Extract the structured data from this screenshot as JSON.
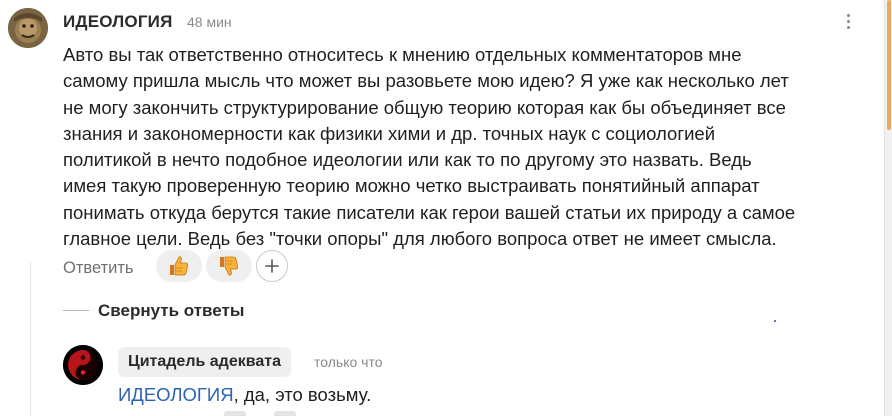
{
  "comment": {
    "author": "ИДЕОЛОГИЯ",
    "time": "48 мин",
    "text_lines": [
      "Авто вы так ответственно относитесь к мнению отдельных комментаторов мне",
      "самому пришла мысль что может вы разовьете мою идею? Я уже как несколько лет",
      "не могу закончить структурирование общую теорию которая как бы объединяет все",
      "знания и закономерности как физики хими и др. точных наук с социологией",
      "политикой в нечто подобное идеологии или как то по другому это назвать. Ведь",
      "имея такую проверенную теорию можно четко выстраивать понятийный аппарат",
      "понимать откуда берутся такие писатели как герои вашей статьи их природу а самое",
      "главное цели. Ведь без \"точки опоры\" для любого вопроса ответ не имеет смысла."
    ],
    "reply_label": "Ответить",
    "icons": {
      "like": "thumbs-up-emoji",
      "dislike": "thumbs-down-emoji",
      "add_reaction": "plus-icon",
      "menu": "more-vertical-icon"
    }
  },
  "thread": {
    "collapse_label": "Свернуть ответы"
  },
  "reply": {
    "author": "Цитадель адеквата",
    "time": "только что",
    "mention": "ИДЕОЛОГИЯ",
    "text": ", да, это возьму."
  },
  "colors": {
    "mention_link": "#2d62b5",
    "scrollbar_thumb": "#f0a85e",
    "reaction_bg": "#efefef"
  }
}
